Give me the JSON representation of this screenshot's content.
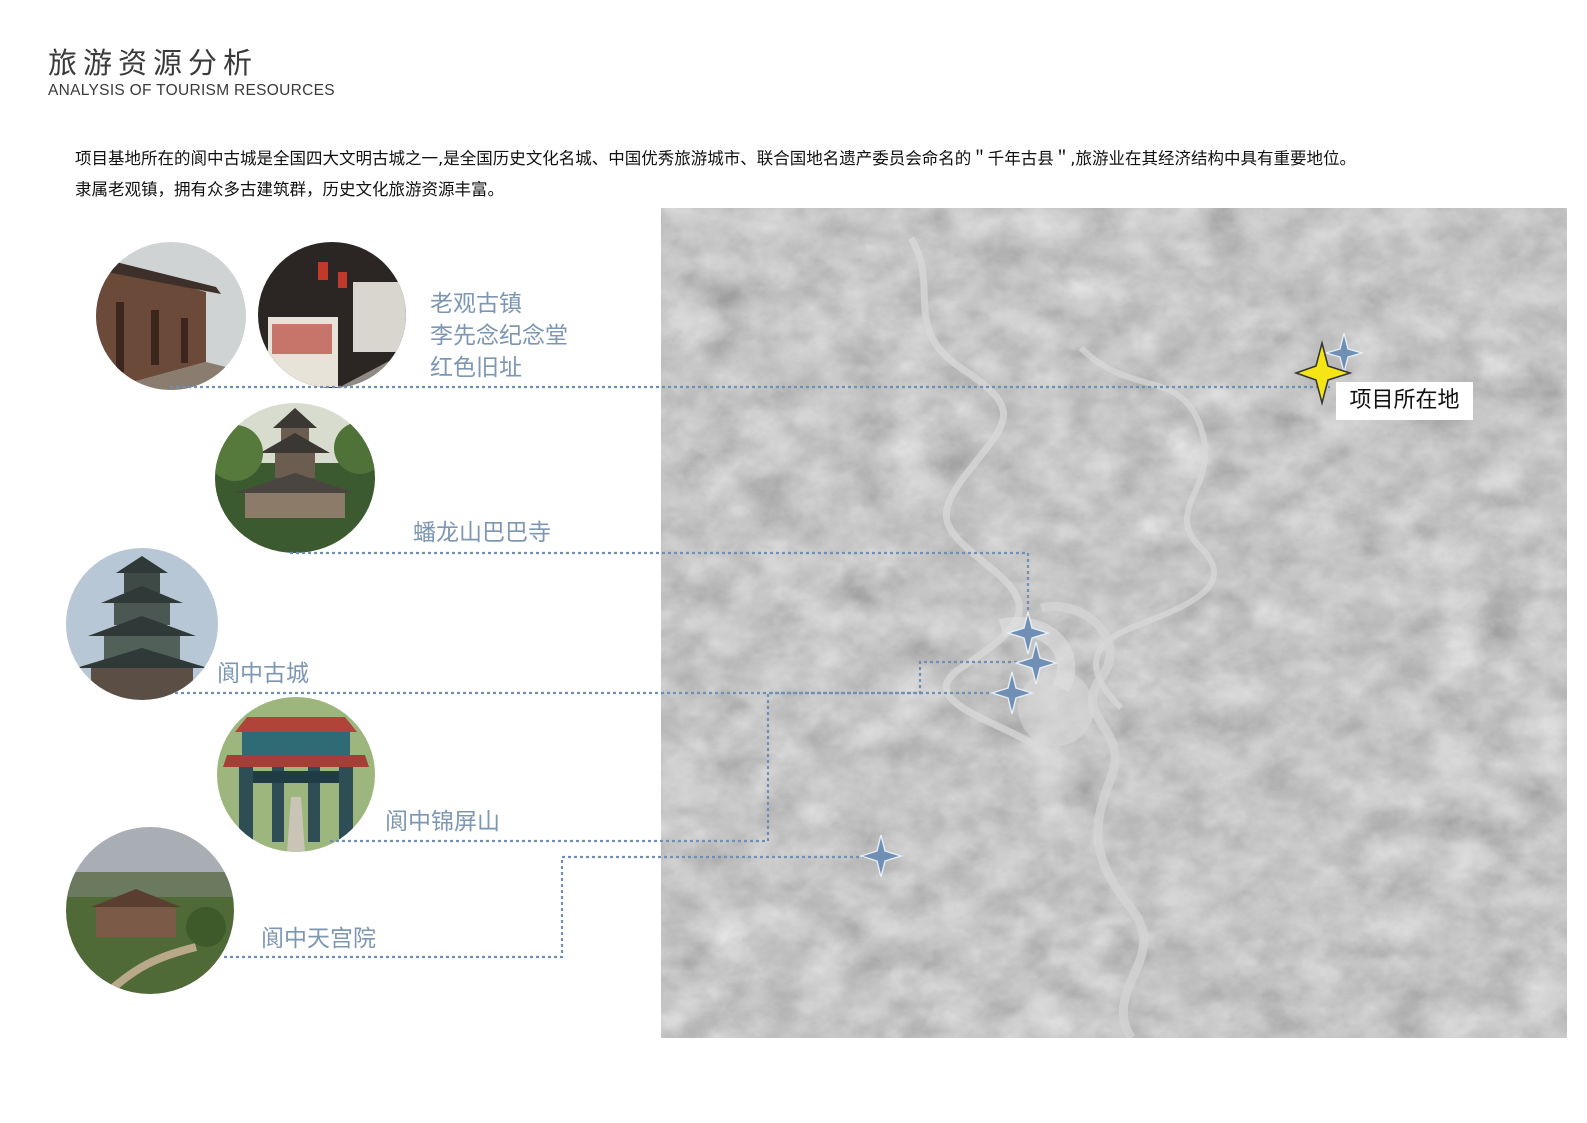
{
  "header": {
    "title_cn": "旅游资源分析",
    "title_en": "ANALYSIS OF TOURISM RESOURCES"
  },
  "intro": {
    "line1": "项目基地所在的阆中古城是全国四大文明古城之一,是全国历史文化名城、中国优秀旅游城市、联合国地名遗产委员会命名的＂千年古县＂,旅游业在其经济结构中具有重要地位。",
    "line2": "隶属老观镇，拥有众多古建筑群，历史文化旅游资源丰富。"
  },
  "map": {
    "project_label": "项目所在地",
    "project_marker_color": "#f5e514",
    "site_marker_color": "#6f8fb5",
    "leader_line_color": "#6f8fb5"
  },
  "sites": [
    {
      "label_lines": [
        "老观古镇",
        "李先念纪念堂",
        "红色旧址"
      ]
    },
    {
      "label": "蟠龙山巴巴寺"
    },
    {
      "label": "阆中古城"
    },
    {
      "label": "阆中锦屏山"
    },
    {
      "label": "阆中天宫院"
    }
  ]
}
